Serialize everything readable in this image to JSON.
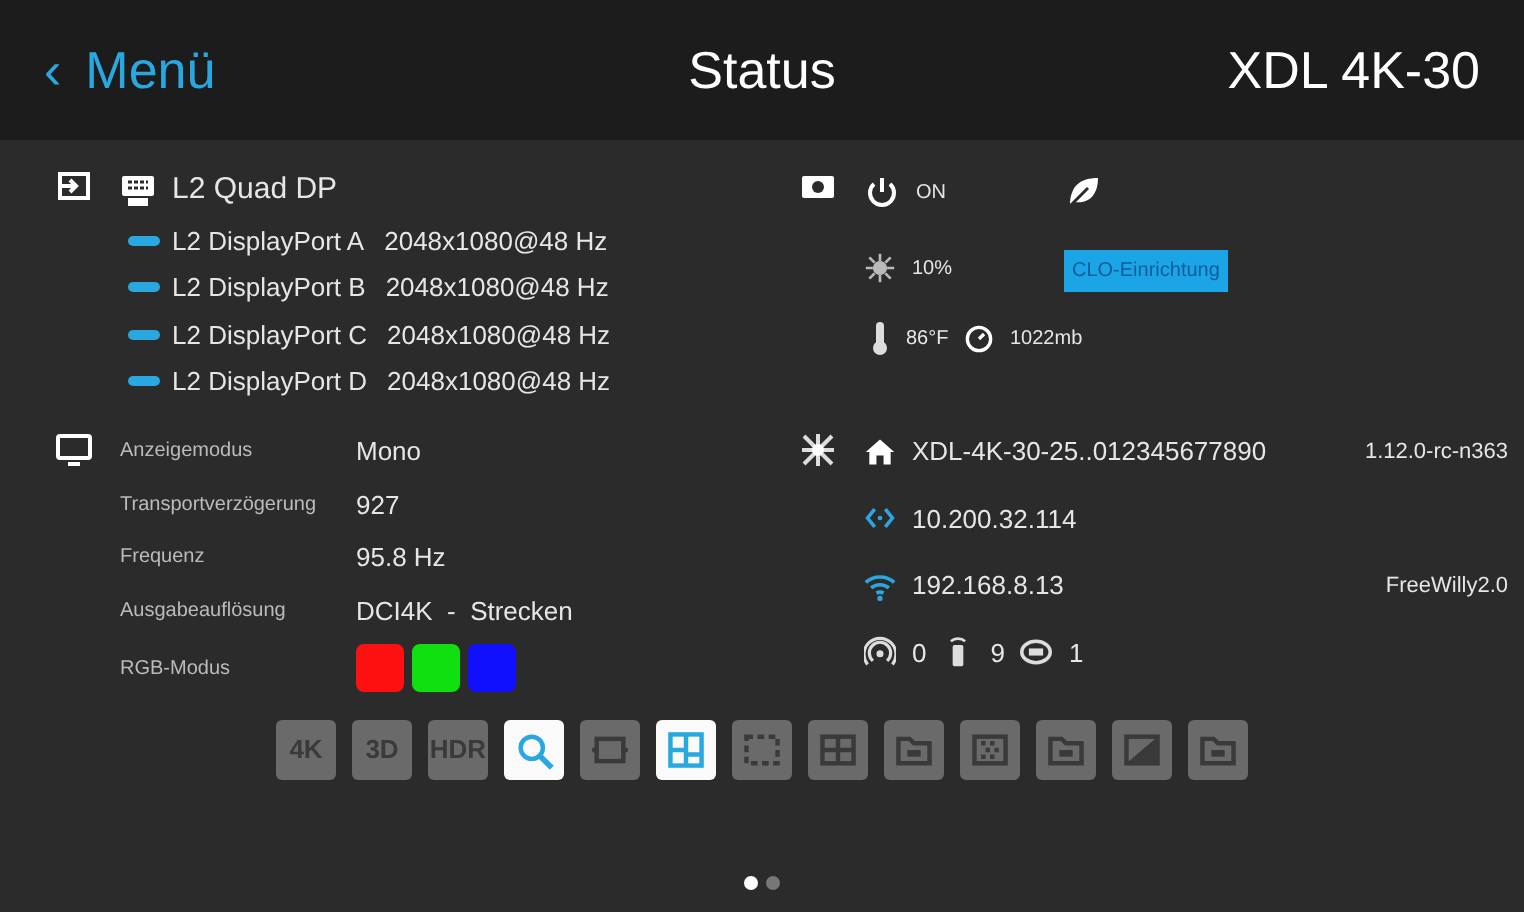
{
  "header": {
    "back": "‹",
    "back_label": "Menü",
    "title": "Status",
    "device": "XDL 4K-30"
  },
  "source": {
    "name": "L2 Quad DP",
    "ports": [
      {
        "name": "L2 DisplayPort A",
        "resolution": "2048x1080@48 Hz"
      },
      {
        "name": "L2 DisplayPort B",
        "resolution": "2048x1080@48 Hz"
      },
      {
        "name": "L2 DisplayPort C",
        "resolution": "2048x1080@48 Hz"
      },
      {
        "name": "L2 DisplayPort D",
        "resolution": "2048x1080@48 Hz"
      }
    ]
  },
  "projector": {
    "power": "ON",
    "brightness": "10%",
    "clo_button": "CLO-Einrichtung",
    "temperature": "86°F",
    "pressure": "1022mb"
  },
  "display": {
    "rows": [
      {
        "label": "Anzeigemodus",
        "value": "Mono"
      },
      {
        "label": "Transportverzögerung",
        "value": "927"
      },
      {
        "label": "Frequenz",
        "value": "95.8 Hz"
      },
      {
        "label": "Ausgabeauflösung",
        "value": "DCI4K  -  Strecken"
      }
    ],
    "rgb_label": "RGB-Modus",
    "rgb": [
      {
        "color": "#ff1010"
      },
      {
        "color": "#10e010"
      },
      {
        "color": "#1010ff"
      }
    ]
  },
  "network": {
    "hostname": "XDL-4K-30-25..012345677890",
    "version": "1.12.0-rc-n363",
    "lan_ip": "10.200.32.114",
    "wifi_ip": "192.168.8.13",
    "ssid": "FreeWilly2.0",
    "counts": [
      {
        "kind": "hotspot",
        "value": "0"
      },
      {
        "kind": "remote",
        "value": "9"
      },
      {
        "kind": "router",
        "value": "1"
      }
    ]
  },
  "features": [
    {
      "kind": "text",
      "label": "4K",
      "on": false
    },
    {
      "kind": "text",
      "label": "3D",
      "on": false
    },
    {
      "kind": "text",
      "label": "HDR",
      "on": false
    },
    {
      "kind": "zoom",
      "on": true
    },
    {
      "kind": "frame",
      "on": false
    },
    {
      "kind": "quad",
      "on": true
    },
    {
      "kind": "dashed",
      "on": false
    },
    {
      "kind": "grid",
      "on": false
    },
    {
      "kind": "folder",
      "on": false
    },
    {
      "kind": "pattern",
      "on": false
    },
    {
      "kind": "folder",
      "on": false
    },
    {
      "kind": "diagonal",
      "on": false
    },
    {
      "kind": "folder",
      "on": false
    }
  ],
  "pages": [
    {
      "selected": true
    },
    {
      "selected": false
    }
  ]
}
